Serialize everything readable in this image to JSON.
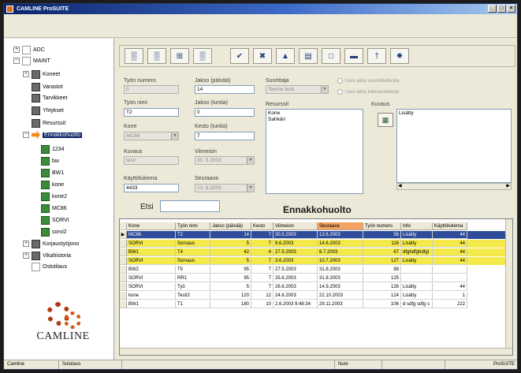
{
  "window": {
    "title": "CAMLINE ProSUITE",
    "controls": [
      "_",
      "□",
      "×"
    ]
  },
  "tree": {
    "items": [
      {
        "label": "ADC",
        "icon": "document-icon",
        "expander": "+",
        "level": 0
      },
      {
        "label": "MAINT",
        "icon": "maintenance-icon",
        "expander": "−",
        "level": 0
      },
      {
        "label": "Koneet",
        "icon": "machines-icon",
        "expander": "+",
        "level": 1
      },
      {
        "label": "Varastot",
        "icon": "warehouse-icon",
        "expander": "",
        "level": 1
      },
      {
        "label": "Tarvikkeet",
        "icon": "supplies-icon",
        "expander": "",
        "level": 1
      },
      {
        "label": "Yhtykset",
        "icon": "companies-icon",
        "expander": "",
        "level": 1
      },
      {
        "label": "Resurssit",
        "icon": "resources-icon",
        "expander": "",
        "level": 1
      },
      {
        "label": "Ennakkohuolto",
        "icon": "arrow-icon",
        "expander": "−",
        "level": 1,
        "selected": true
      },
      {
        "label": "1234",
        "icon": "machine-icon",
        "expander": "",
        "level": 2
      },
      {
        "label": "bw",
        "icon": "machine-icon",
        "expander": "",
        "level": 2
      },
      {
        "label": "BW1",
        "icon": "machine-icon",
        "expander": "",
        "level": 2
      },
      {
        "label": "kone",
        "icon": "machine-icon",
        "expander": "",
        "level": 2
      },
      {
        "label": "kone2",
        "icon": "machine-icon",
        "expander": "",
        "level": 2
      },
      {
        "label": "MC86",
        "icon": "machine-icon",
        "expander": "",
        "level": 2
      },
      {
        "label": "SORVI",
        "icon": "machine-icon",
        "expander": "",
        "level": 2
      },
      {
        "label": "sorvi2",
        "icon": "machine-icon",
        "expander": "",
        "level": 2
      },
      {
        "label": "Korjaustyöjono",
        "icon": "repair-queue-icon",
        "expander": "+",
        "level": 1
      },
      {
        "label": "Vikahistoria",
        "icon": "fault-history-icon",
        "expander": "+",
        "level": 1
      },
      {
        "label": "Ostotilaus",
        "icon": "purchase-order-icon",
        "expander": "",
        "level": 1
      }
    ]
  },
  "logo": {
    "text": "CAMLINE"
  },
  "toolbar": {
    "buttons": [
      {
        "name": "filter-icon",
        "glyph": "▒"
      },
      {
        "name": "filter-down-icon",
        "glyph": "▒"
      },
      {
        "name": "refresh-icon",
        "glyph": "⊞"
      },
      {
        "name": "filter-up-icon",
        "glyph": "▒"
      },
      {
        "name": "check-icon",
        "glyph": "✔"
      },
      {
        "name": "cancel-icon",
        "glyph": "✖"
      },
      {
        "name": "erase-icon",
        "glyph": "▲"
      },
      {
        "name": "print-icon",
        "glyph": "▤"
      },
      {
        "name": "document-icon",
        "glyph": "□"
      },
      {
        "name": "grid-icon",
        "glyph": "▬"
      },
      {
        "name": "tool-icon",
        "glyph": "†"
      },
      {
        "name": "settings-icon",
        "glyph": "✸"
      }
    ]
  },
  "form": {
    "tyonumero": {
      "label": "Työn numero",
      "value": "0"
    },
    "jakso_paiva": {
      "label": "Jakso (päivää)",
      "value": "14"
    },
    "suorittaja": {
      "label": "Suorittaja",
      "value": "Teemu testi"
    },
    "radio1": "Uusi aika suunnitellusta",
    "radio2": "Uusi aika toteutuneesta",
    "tyonimi": {
      "label": "Työn nimi",
      "value": "T2"
    },
    "jakso_tunti": {
      "label": "Jakso (tuntia)",
      "value": "0"
    },
    "resurssit": {
      "label": "Resurssit",
      "items": [
        "Kone",
        "Sahkäri"
      ]
    },
    "kuvaus_right": {
      "label": "Kuvaus",
      "value": "Lisätty"
    },
    "kone": {
      "label": "Kone",
      "value": "MC86"
    },
    "kesto": {
      "label": "Kesto (tuntia)",
      "value": "7"
    },
    "kuvaus": {
      "label": "Kuvaus",
      "value": "testi"
    },
    "viimeisin": {
      "label": "Viimeisin",
      "value": "30. 5.2003"
    },
    "kayttolukema": {
      "label": "Käyttölukema",
      "value": "4433"
    },
    "seuraava": {
      "label": "Seuraava",
      "value": "13. 6.2003"
    }
  },
  "search": {
    "label": "Etsi",
    "value": ""
  },
  "grid": {
    "title": "Ennakkohuolto",
    "columns": [
      "Kone",
      "Työn nimi",
      "Jakso (päivää)",
      "Kesto",
      "Viimeisin",
      "Seuraava",
      "Työn numero",
      "Info",
      "Käyttölukema"
    ],
    "rows": [
      {
        "state": "sel",
        "cells": [
          "MC86",
          "T2",
          "14",
          "7",
          "30.5.2003",
          "13.6.2003",
          "56",
          "Lisätty",
          "44"
        ]
      },
      {
        "state": "hl",
        "cells": [
          "SORVI",
          "Sorvaus",
          "5",
          "7",
          "9.6.2003",
          "14.6.2003",
          "116",
          "Lisätty",
          "44"
        ]
      },
      {
        "state": "hl",
        "cells": [
          "BW1",
          "T4",
          "42",
          "4",
          "27.5.2003",
          "8.7.2003",
          "67",
          "dfghdfghdfgl",
          "44"
        ]
      },
      {
        "state": "hl",
        "cells": [
          "SORVI",
          "Sorvaus",
          "5",
          "7",
          "3.6.2003",
          "10.7.2003",
          "127",
          "Lisätty",
          "44"
        ]
      },
      {
        "state": "",
        "cells": [
          "BW2",
          "T5",
          "95",
          "7",
          "27.5.2003",
          "31.8.2003",
          "88",
          "",
          ""
        ]
      },
      {
        "state": "",
        "cells": [
          "SORVI",
          "RR1",
          "95",
          "7",
          "25.6.2003",
          "31.8.2003",
          "125",
          "",
          ""
        ]
      },
      {
        "state": "",
        "cells": [
          "SORVI",
          "Työ",
          "5",
          "7",
          "26.6.2003",
          "14.9.2003",
          "126",
          "Lisätty",
          "44"
        ]
      },
      {
        "state": "",
        "cells": [
          "kone",
          "Testi3",
          "120",
          "12",
          "24.6.2003",
          "22.10.2003",
          "124",
          "Lisätty",
          "1"
        ]
      },
      {
        "state": "",
        "cells": [
          "BW1",
          "T1",
          "180",
          "10",
          "2.6.2003 9:48:34",
          "29.11.2003",
          "106",
          "d sdfg sdfg s",
          "222"
        ]
      }
    ]
  },
  "statusbar": [
    "Camline",
    "Solutaso",
    "",
    "Num",
    "",
    "ProSUITE"
  ]
}
